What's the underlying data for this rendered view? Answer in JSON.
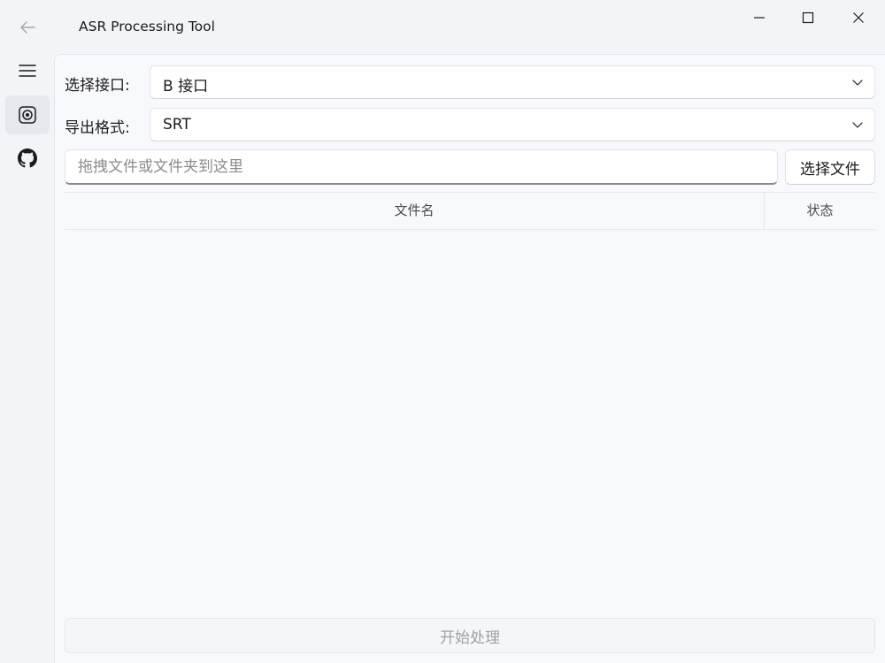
{
  "window": {
    "title": "ASR Processing Tool",
    "controls": [
      "minimize-icon",
      "maximize-icon",
      "close-icon"
    ]
  },
  "nav": {
    "items": [
      {
        "icon": "menu-icon"
      },
      {
        "icon": "asr-record-icon",
        "selected": true
      },
      {
        "icon": "github-icon"
      }
    ],
    "accent": "#0a8f9a"
  },
  "form": {
    "interface_label": "选择接口:",
    "interface_value": "B 接口",
    "format_label": "导出格式:",
    "format_value": "SRT",
    "drop_placeholder": "拖拽文件或文件夹到这里",
    "select_file_label": "选择文件"
  },
  "table": {
    "columns": [
      "文件名",
      "状态"
    ],
    "rows": []
  },
  "actions": {
    "start_label": "开始处理"
  }
}
